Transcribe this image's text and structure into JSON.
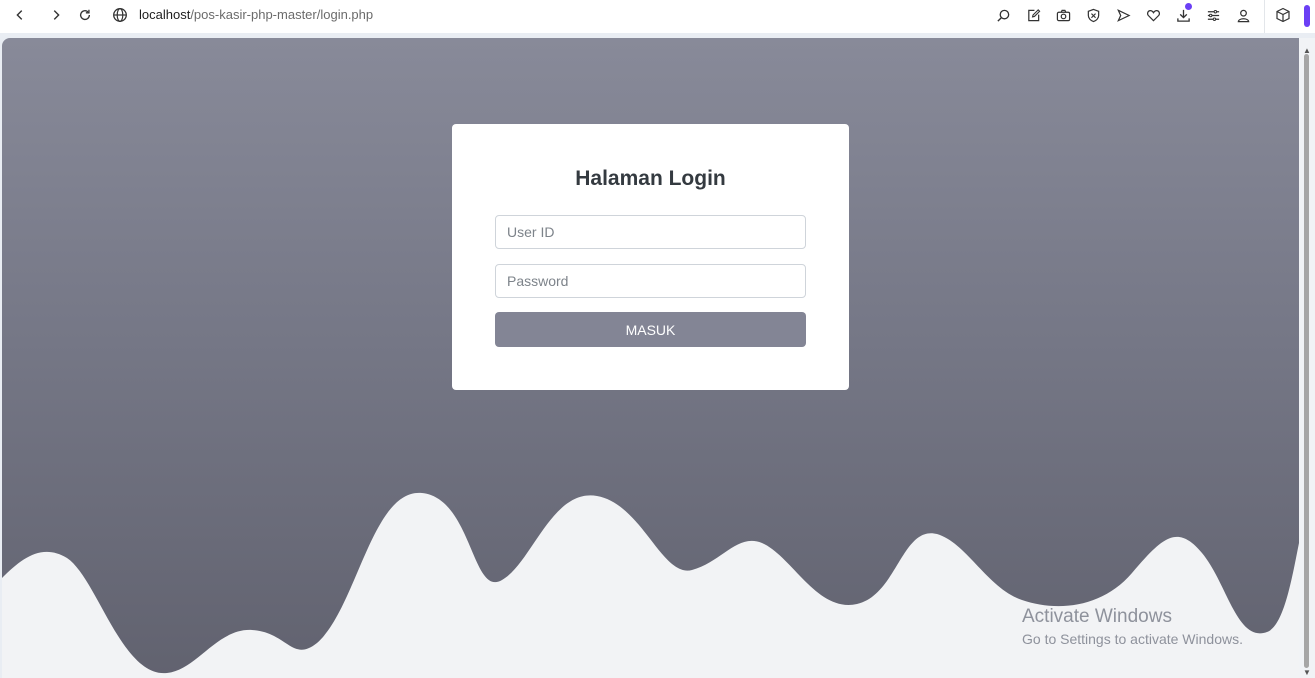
{
  "browser": {
    "url_host": "localhost",
    "url_path": "/pos-kasir-php-master/login.php",
    "accent_color": "#6b3ff5",
    "toolbar_icons": [
      "search-icon",
      "edit-icon",
      "camera-icon",
      "shield-icon",
      "send-icon",
      "heart-icon",
      "download-icon",
      "menu-icon",
      "user-icon"
    ],
    "extension_icon": "cube-icon"
  },
  "login": {
    "title": "Halaman Login",
    "userid_placeholder": "User ID",
    "userid_value": "",
    "password_placeholder": "Password",
    "password_value": "",
    "submit_label": "MASUK",
    "button_color": "#838595"
  },
  "watermark": {
    "title": "Activate Windows",
    "subtitle": "Go to Settings to activate Windows."
  },
  "colors": {
    "background_top": "#888a99",
    "background_bottom": "#61626f",
    "wave": "#f2f3f5"
  }
}
